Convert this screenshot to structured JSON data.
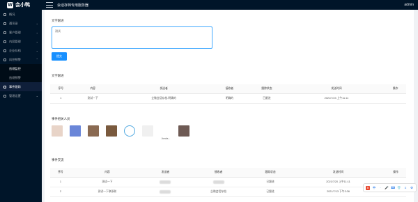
{
  "header": {
    "logo_mark": "W",
    "logo_text": "会小鸭",
    "title": "会话存档专用服务器",
    "user": "admin"
  },
  "sidebar": {
    "items": [
      {
        "label": "概况",
        "arrow": ""
      },
      {
        "label": "通讯录",
        "arrow": "⌄"
      },
      {
        "label": "客户管理",
        "arrow": "⌄"
      },
      {
        "label": "内容管理",
        "arrow": "⌄"
      },
      {
        "label": "企业存档",
        "arrow": "⌄"
      },
      {
        "label": "风控预警",
        "arrow": "⌃"
      },
      {
        "label": "违规监控",
        "arrow": "",
        "sub": true,
        "selected": true
      },
      {
        "label": "违规预警",
        "arrow": "",
        "sub": true
      },
      {
        "label": "事件跟踪",
        "arrow": "",
        "active": true
      },
      {
        "label": "管理设置",
        "arrow": "⌄"
      }
    ]
  },
  "form": {
    "section_title": "文字跟进",
    "textarea_value": "测试",
    "submit_label": "提交"
  },
  "table1": {
    "section_title": "文字跟进",
    "headers": [
      "序号",
      "内容",
      "发送者",
      "接收者",
      "跟踪状态",
      "发送时间",
      "操作"
    ],
    "rows": [
      [
        "1",
        "测试一下",
        "企微会话存档-明确的",
        "明确的",
        "已跟进",
        "2021/7/23 上午11:11",
        ""
      ]
    ]
  },
  "people": {
    "section_title": "事件相关人员",
    "list": [
      {
        "name": "",
        "color": "#e8d4c8"
      },
      {
        "name": "",
        "color": "#6a86d8"
      },
      {
        "name": "",
        "color": "#8a6a52"
      },
      {
        "name": "",
        "color": "#7a5a3e"
      },
      {
        "name": "",
        "color": "#4fa8e0"
      },
      {
        "name": "",
        "color": "#d8d8d8"
      },
      {
        "name": "Jonda...",
        "color": "#ffffff"
      },
      {
        "name": "",
        "color": "#6e5a54"
      }
    ]
  },
  "table2": {
    "section_title": "事件交流",
    "headers": [
      "序号",
      "内容",
      "发送者",
      "接收者",
      "跟踪状态",
      "发送时间",
      "操作"
    ],
    "rows": [
      [
        "1",
        "测试一下",
        "",
        "",
        "已跟进",
        "2021/7/20 上午11:11",
        ""
      ],
      [
        "2",
        "测试一下联系联",
        "",
        "企微会话存档",
        "已跟进",
        "2021/7/13 下午3:36",
        ""
      ]
    ]
  },
  "toolbar": {
    "icons": [
      "S",
      "中",
      "·",
      "🎤",
      "⌨",
      "👕",
      "≡",
      "⚙"
    ]
  }
}
